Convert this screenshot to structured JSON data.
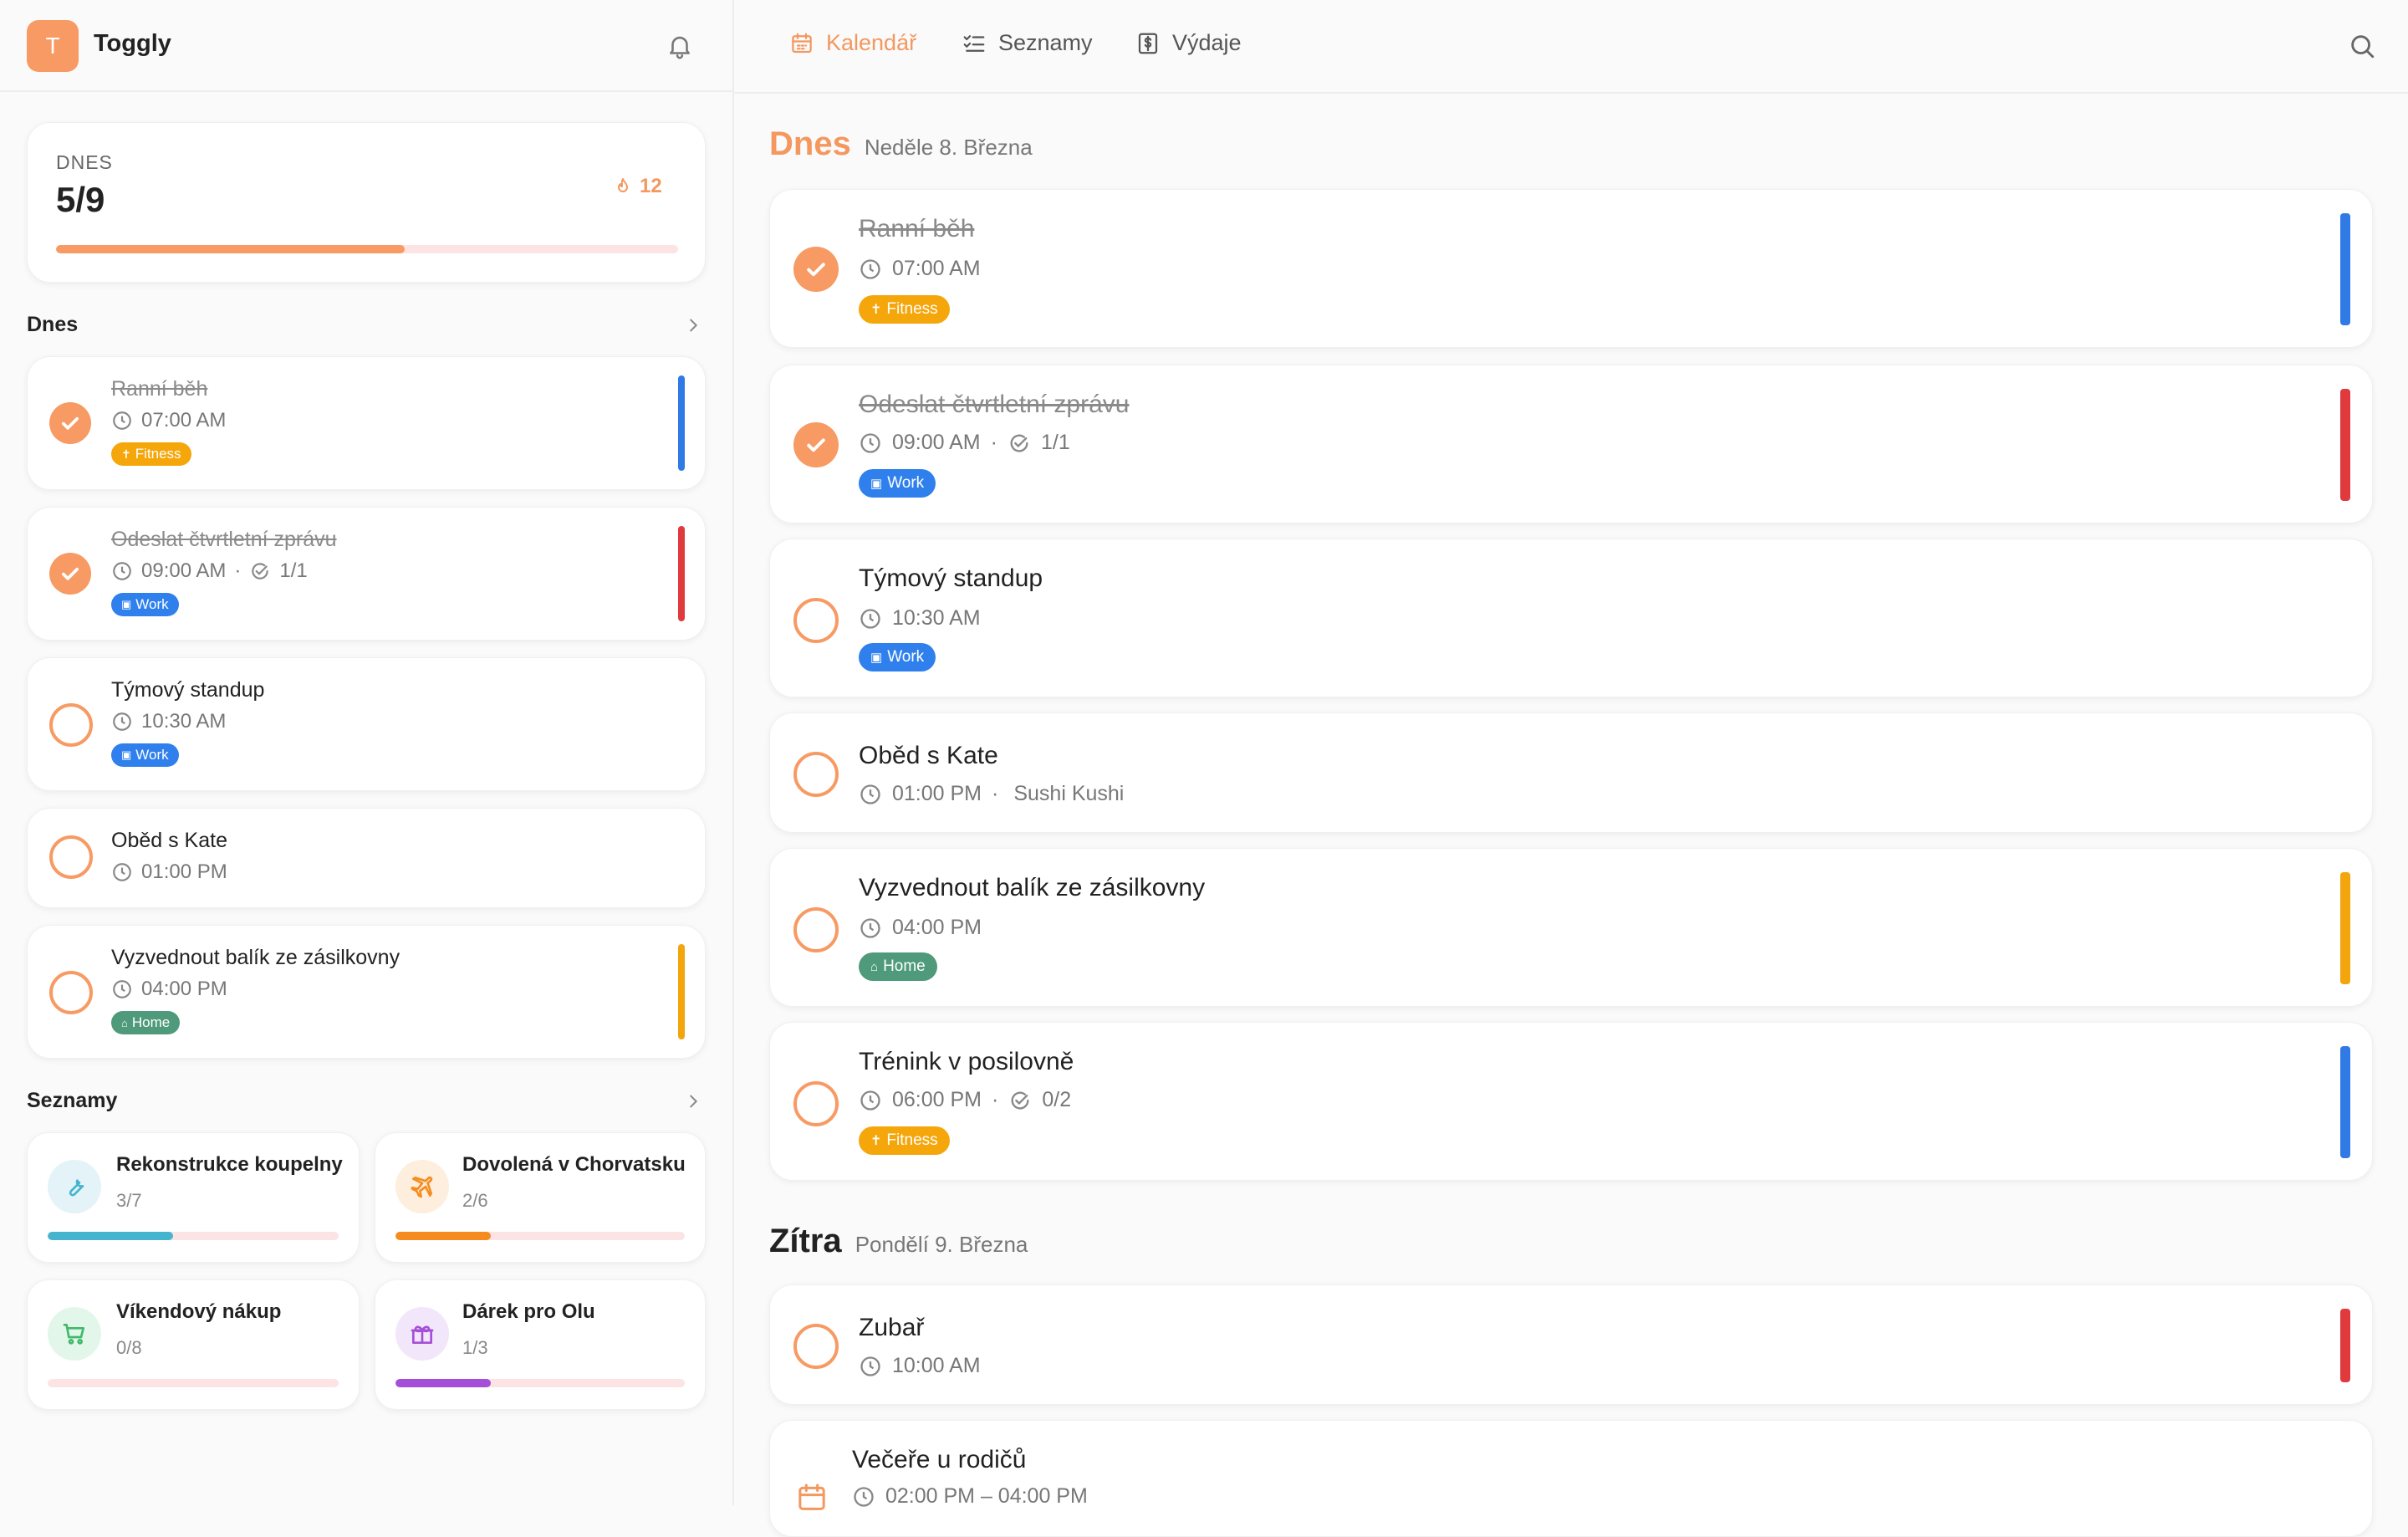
{
  "app": {
    "logo_letter": "T",
    "name": "Toggly"
  },
  "summary": {
    "label": "DNES",
    "value": "5/9",
    "streak": "12",
    "progress": 0.56
  },
  "sidebar": {
    "today_title": "Dnes",
    "lists_title": "Seznamy",
    "tasks": [
      {
        "title": "Ranní běh",
        "time": "07:00 AM",
        "tag": "Fitness",
        "done": true
      },
      {
        "title": "Odeslat čtvrtletní zprávu",
        "time": "09:00 AM",
        "sub": "1/1",
        "tag": "Work",
        "done": true
      },
      {
        "title": "Týmový standup",
        "time": "10:30 AM",
        "tag": "Work",
        "done": false
      },
      {
        "title": "Oběd s Kate",
        "time": "01:00 PM",
        "done": false
      },
      {
        "title": "Vyzvednout balík ze zásilkovny",
        "time": "04:00 PM",
        "tag": "Home",
        "done": false
      }
    ],
    "lists": [
      {
        "name": "Rekonstrukce koupelny",
        "count": "3/7",
        "progress": 0.43,
        "color": "#45b5cf",
        "icon": "wrench-icon"
      },
      {
        "name": "Dovolená v Chorvatsku",
        "count": "2/6",
        "progress": 0.33,
        "color": "#f68c1f",
        "icon": "plane-icon"
      },
      {
        "name": "Víkendový nákup",
        "count": "0/8",
        "progress": 0,
        "color": "#3fb96b",
        "icon": "cart-icon"
      },
      {
        "name": "Dárek pro Olu",
        "count": "1/3",
        "progress": 0.33,
        "color": "#a54fd8",
        "icon": "gift-icon"
      }
    ]
  },
  "nav": [
    {
      "label": "Kalendář",
      "icon": "calendar-icon",
      "active": true
    },
    {
      "label": "Seznamy",
      "icon": "checklist-icon",
      "active": false
    },
    {
      "label": "Výdaje",
      "icon": "dollar-doc-icon",
      "active": false
    }
  ],
  "today": {
    "name": "Dnes",
    "date": "Neděle 8. Března",
    "tasks": [
      {
        "title": "Ranní běh",
        "time": "07:00 AM",
        "tag": "Fitness",
        "done": true
      },
      {
        "title": "Odeslat čtvrtletní zprávu",
        "time": "09:00 AM",
        "sub": "1/1",
        "tag": "Work",
        "done": true
      },
      {
        "title": "Týmový standup",
        "time": "10:30 AM",
        "tag": "Work",
        "done": false
      },
      {
        "title": "Oběd s Kate",
        "time": "01:00 PM",
        "location": "Sushi Kushi",
        "done": false
      },
      {
        "title": "Vyzvednout balík ze zásilkovny",
        "time": "04:00 PM",
        "tag": "Home",
        "done": false
      },
      {
        "title": "Trénink v posilovně",
        "time": "06:00 PM",
        "sub": "0/2",
        "tag": "Fitness",
        "done": false
      }
    ]
  },
  "tomorrow": {
    "name": "Zítra",
    "date": "Pondělí 9. Března",
    "tasks": [
      {
        "title": "Zubař",
        "time": "10:00 AM",
        "done": false
      },
      {
        "title": "Večeře u rodičů",
        "time": "02:00 PM – 04:00 PM",
        "done": false
      }
    ]
  },
  "colors": {
    "accent": "#f79a63",
    "fitness": "#f5a60a",
    "work": "#2f80ed",
    "home": "#4e9a7a",
    "blue": "#2f7ae5",
    "red": "#e03a3e",
    "yellow": "#f2a50c"
  }
}
